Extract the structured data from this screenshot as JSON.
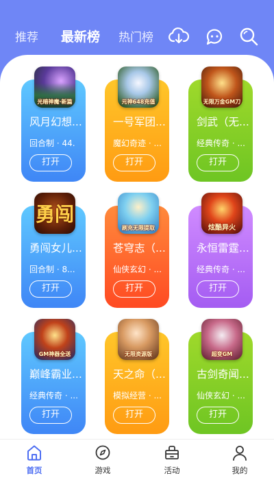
{
  "header": {
    "tabs": [
      {
        "label": "推荐",
        "active": false
      },
      {
        "label": "最新榜",
        "active": true
      },
      {
        "label": "热门榜",
        "active": false
      }
    ],
    "icons": [
      "download-icon",
      "chat-icon",
      "search-icon"
    ]
  },
  "games": [
    {
      "name": "风月幻想...",
      "meta": "回合制 · 44.",
      "button": "打开",
      "icon_text": "光暗神魔·新篇",
      "color": "blue"
    },
    {
      "name": "一号军团...",
      "meta": "魔幻奇迹 · ...",
      "button": "打开",
      "icon_text": "元神648充值",
      "color": "orange"
    },
    {
      "name": "剑武（无...",
      "meta": "经典传奇 · ...",
      "button": "打开",
      "icon_text": "无限万金GM刀",
      "color": "green"
    },
    {
      "name": "勇闯女儿...",
      "meta": "回合制 · 8...",
      "button": "打开",
      "icon_text": "勇闯",
      "color": "blue"
    },
    {
      "name": "苍穹志（...",
      "meta": "仙侠玄幻 · ...",
      "button": "打开",
      "icon_text": "刷充无限提取",
      "color": "red"
    },
    {
      "name": "永恒雷霆...",
      "meta": "经典传奇 · ...",
      "button": "打开",
      "icon_text": "炫酷异火",
      "color": "purple"
    },
    {
      "name": "巅峰霸业...",
      "meta": "经典传奇 · ...",
      "button": "打开",
      "icon_text": "GM神器全送",
      "color": "blue"
    },
    {
      "name": "天之命（...",
      "meta": "模拟经营 · ...",
      "button": "打开",
      "icon_text": "无限资源版",
      "color": "orange"
    },
    {
      "name": "古剑奇闻...",
      "meta": "仙侠玄幻 · ...",
      "button": "打开",
      "icon_text": "超变GM",
      "color": "green"
    }
  ],
  "bottom_nav": [
    {
      "label": "首页",
      "active": true
    },
    {
      "label": "游戏",
      "active": false
    },
    {
      "label": "活动",
      "active": false
    },
    {
      "label": "我的",
      "active": false
    }
  ],
  "colors": {
    "header_bg": "#6f86f6",
    "active_nav": "#4d6ef2"
  }
}
